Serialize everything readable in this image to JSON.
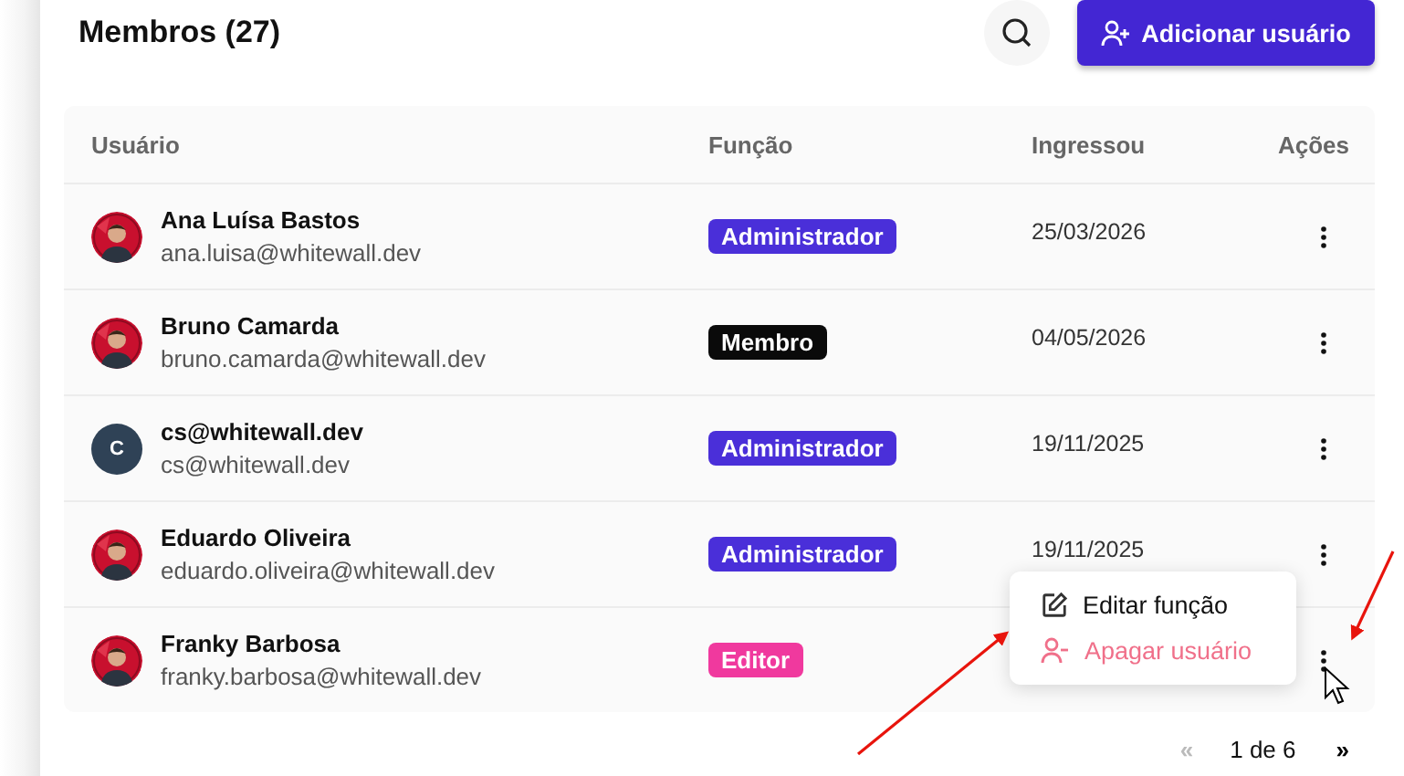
{
  "title": "Membros (27)",
  "add_button": {
    "label": "Adicionar usuário"
  },
  "table": {
    "columns": [
      "Usuário",
      "Função",
      "Ingressou",
      "Ações"
    ],
    "rows": [
      {
        "name": "Ana Luísa Bastos",
        "email": "ana.luisa@whitewall.dev",
        "role": {
          "label": "Administrador",
          "color": "#4a2fd9"
        },
        "joined": "25/03/2026"
      },
      {
        "name": "Bruno Camarda",
        "email": "bruno.camarda@whitewall.dev",
        "role": {
          "label": "Membro",
          "color": "#0a0a0a"
        },
        "joined": "04/05/2026"
      },
      {
        "name": "cs@whitewall.dev",
        "email": "cs@whitewall.dev",
        "avatar": {
          "kind": "initial",
          "initial": "C"
        },
        "role": {
          "label": "Administrador",
          "color": "#4a2fd9"
        },
        "joined": "19/11/2025"
      },
      {
        "name": "Eduardo Oliveira",
        "email": "eduardo.oliveira@whitewall.dev",
        "role": {
          "label": "Administrador",
          "color": "#4a2fd9"
        },
        "joined": "19/11/2025"
      },
      {
        "name": "Franky Barbosa",
        "email": "franky.barbosa@whitewall.dev",
        "role": {
          "label": "Editor",
          "color": "#f0399e"
        },
        "joined": ""
      }
    ]
  },
  "context_menu": {
    "items": [
      {
        "label": "Editar função",
        "kind": "edit"
      },
      {
        "label": "Apagar usuário",
        "kind": "delete"
      }
    ]
  },
  "pagination": {
    "first": "«",
    "page": "1 de 6",
    "last": "»"
  }
}
